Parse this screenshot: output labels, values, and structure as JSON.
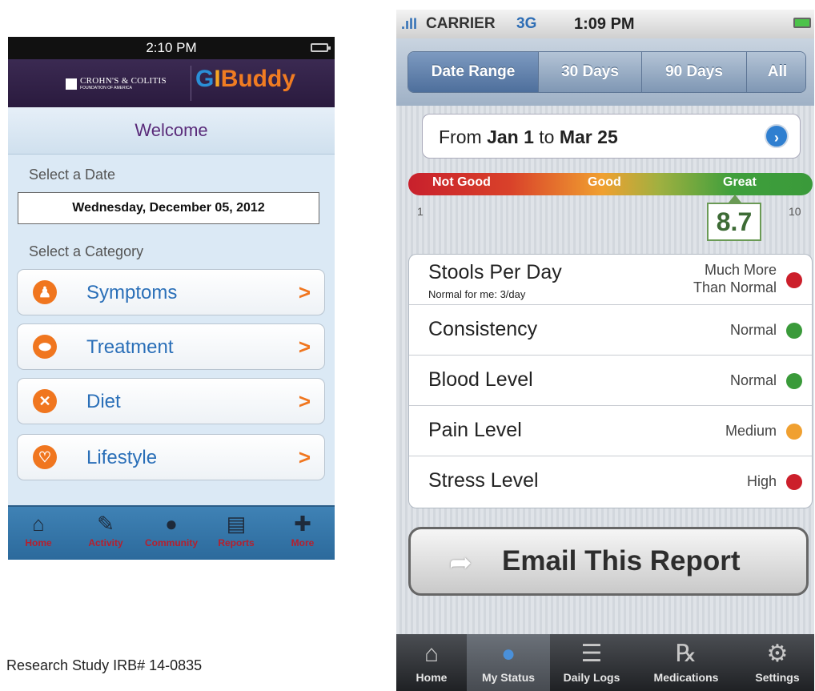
{
  "left_app": {
    "status_time": "2:10 PM",
    "header": {
      "foundation_line1": "CROHN'S & COLITIS",
      "foundation_line2": "FOUNDATION OF AMERICA",
      "logo_g": "G",
      "logo_i": "I",
      "logo_rest": "Buddy"
    },
    "welcome": "Welcome",
    "select_date_label": "Select a Date",
    "date_value": "Wednesday, December 05, 2012",
    "select_category_label": "Select a Category",
    "categories": [
      {
        "label": "Symptoms",
        "icon": "person-icon",
        "glyph": "♟"
      },
      {
        "label": "Treatment",
        "icon": "pill-icon",
        "glyph": "⬬"
      },
      {
        "label": "Diet",
        "icon": "utensils-icon",
        "glyph": "✕"
      },
      {
        "label": "Lifestyle",
        "icon": "heart-icon",
        "glyph": "♡"
      }
    ],
    "tabs": [
      {
        "label": "Home",
        "icon": "home-icon",
        "glyph": "⌂"
      },
      {
        "label": "Activity",
        "icon": "pencil-icon",
        "glyph": "✎"
      },
      {
        "label": "Community",
        "icon": "person-icon",
        "glyph": "●"
      },
      {
        "label": "Reports",
        "icon": "document-icon",
        "glyph": "▤"
      },
      {
        "label": "More",
        "icon": "plus-icon",
        "glyph": "✚"
      }
    ],
    "colors": {
      "accent": "#f0761f",
      "header": "#2a1a3e",
      "category_text": "#2a6fb8",
      "tab_label": "#b5202e"
    }
  },
  "right_app": {
    "status": {
      "signal": ".ıll",
      "carrier": "CARRIER",
      "network": "3G",
      "time": "1:09 PM"
    },
    "segments": [
      {
        "label": "Date Range",
        "selected": true
      },
      {
        "label": "30 Days",
        "selected": false
      },
      {
        "label": "90 Days",
        "selected": false
      },
      {
        "label": "All",
        "selected": false
      }
    ],
    "range": {
      "from": "From ",
      "start": "Jan 1",
      "to": " to ",
      "end": "Mar 25",
      "arrow": "›"
    },
    "scale": {
      "not_good": "Not Good",
      "good": "Good",
      "great": "Great",
      "min": "1",
      "max": "10",
      "score": "8.7"
    },
    "metrics": [
      {
        "name": "Stools Per Day",
        "sub": "Normal for me: 3/day",
        "status_line1": "Much More",
        "status_line2": "Than Normal",
        "color": "#cc1f2b"
      },
      {
        "name": "Consistency",
        "sub": "",
        "status_line1": "Normal",
        "status_line2": "",
        "color": "#3a9a3a"
      },
      {
        "name": "Blood Level",
        "sub": "",
        "status_line1": "Normal",
        "status_line2": "",
        "color": "#3a9a3a"
      },
      {
        "name": "Pain Level",
        "sub": "",
        "status_line1": "Medium",
        "status_line2": "",
        "color": "#f0a030"
      },
      {
        "name": "Stress Level",
        "sub": "",
        "status_line1": "High",
        "status_line2": "",
        "color": "#cc1f2b"
      }
    ],
    "email_button": "Email This Report",
    "tabs": [
      {
        "label": "Home",
        "icon": "home-icon",
        "glyph": "⌂",
        "selected": false
      },
      {
        "label": "My Status",
        "icon": "person-icon",
        "glyph": "●",
        "selected": true
      },
      {
        "label": "Daily Logs",
        "icon": "list-icon",
        "glyph": "☰",
        "selected": false
      },
      {
        "label": "Medications",
        "icon": "rx-icon",
        "glyph": "℞",
        "selected": false
      },
      {
        "label": "Settings",
        "icon": "gear-icon",
        "glyph": "⚙",
        "selected": false
      }
    ]
  },
  "caption": "Research Study IRB# 14-0835"
}
